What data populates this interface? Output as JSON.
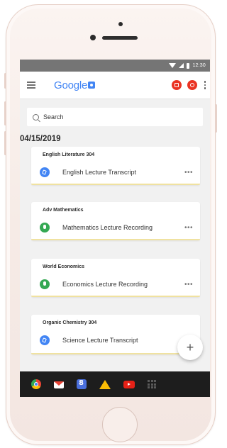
{
  "statusbar": {
    "time": "12:30"
  },
  "appbar": {
    "logo_text": "Google",
    "icons": [
      "menu-icon",
      "calendar-icon",
      "record-icon",
      "more-vert-icon"
    ]
  },
  "search": {
    "label": "Search"
  },
  "date": "04/15/2019",
  "cards": [
    {
      "course": "English Literature 304",
      "title": "English Lecture Transcript",
      "icon": "document-icon",
      "more": "•••"
    },
    {
      "course": "Adv Mathematics",
      "title": "Mathematics Lecture Recording",
      "icon": "microphone-icon",
      "more": "•••"
    },
    {
      "course": "World Economics",
      "title": "Economics Lecture Recording",
      "icon": "microphone-icon",
      "more": "•••"
    },
    {
      "course": "Organic Chemistry 304",
      "title": "Science Lecture Transcript",
      "icon": "document-icon",
      "more": ""
    }
  ],
  "fab": {
    "label": "+"
  },
  "dock": {
    "apps": [
      "chrome-icon",
      "gmail-icon",
      "google-plus-icon",
      "drive-icon",
      "youtube-icon",
      "app-grid-icon"
    ]
  },
  "colors": {
    "accent_blue": "#4285f4",
    "accent_green": "#34a853",
    "accent_red": "#ea3323",
    "card_underline": "#f0e2a0",
    "statusbar": "#757575",
    "dock": "#1d1d1d"
  }
}
